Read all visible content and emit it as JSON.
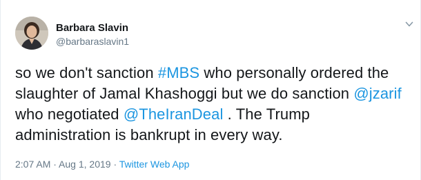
{
  "author": {
    "display_name": "Barbara Slavin",
    "handle": "@barbaraslavin1",
    "avatar": "avatar-photo"
  },
  "tweet": {
    "lines": [
      [
        {
          "text": "so we don't sanction ",
          "link": false
        },
        {
          "text": "#MBS",
          "link": true
        },
        {
          "text": " who personally ordered the",
          "link": false
        }
      ],
      [
        {
          "text": "slaughter of Jamal Khashoggi but we do sanction ",
          "link": false
        },
        {
          "text": "@jzarif",
          "link": true
        }
      ],
      [
        {
          "text": "who negotiated ",
          "link": false
        },
        {
          "text": "@TheIranDeal",
          "link": true
        },
        {
          "text": " . The Trump",
          "link": false
        }
      ],
      [
        {
          "text": "administration is bankrupt in every way.",
          "link": false
        }
      ]
    ]
  },
  "meta": {
    "time": "2:07 AM",
    "sep1": " · ",
    "date": "Aug 1, 2019",
    "sep2": " · ",
    "source": "Twitter Web App"
  },
  "colors": {
    "link": "#1b95e0",
    "text": "#14171a",
    "secondary": "#657786"
  },
  "icons": {
    "menu": "chevron-down-icon"
  }
}
